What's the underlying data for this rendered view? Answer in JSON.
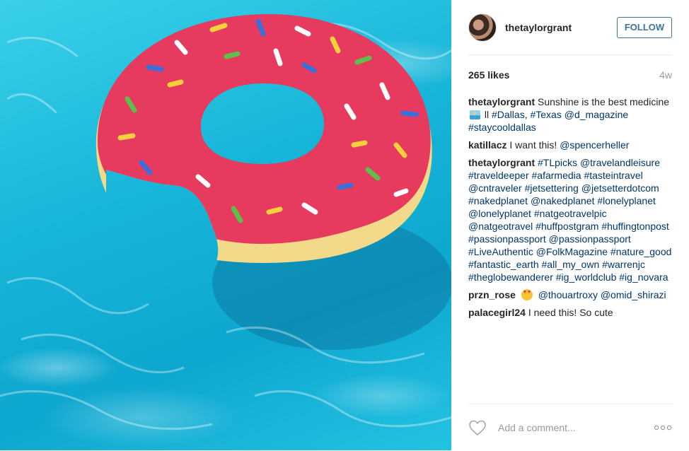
{
  "post": {
    "image_alt": "Donut pool float in a swimming pool",
    "header": {
      "username": "thetaylorgrant",
      "follow_label": "FOLLOW"
    },
    "likes": "265 likes",
    "time_ago": "4w",
    "caption": {
      "username": "thetaylorgrant",
      "text_1": "Sunshine is the best medicine",
      "emoji": "swimmer-emoji",
      "separator": " ll ",
      "tags": [
        "#Dallas",
        "#Texas",
        "@d_magazine",
        "#staycooldallas"
      ]
    },
    "comments": [
      {
        "username": "katillacz",
        "text": "I want this!",
        "mentions": [
          "@spencerheller"
        ]
      },
      {
        "username": "thetaylorgrant",
        "tags": [
          "#TLpicks",
          "@travelandleisure",
          "#traveldeeper",
          "#afarmedia",
          "#tasteintravel",
          "@cntraveler",
          "#jetsettering",
          "@jetsetterdotcom",
          "#nakedplanet",
          "@nakedplanet",
          "#lonelyplanet",
          "@lonelyplanet",
          "#natgeotravelpic",
          "@natgeotravel",
          "#huffpostgram",
          "#huffingtonpost",
          "#passionpassport",
          "@passionpassport",
          "#LiveAuthentic",
          "@FolkMagazine",
          "#nature_good",
          "#fantastic_earth",
          "#all_my_own",
          "#warrenjc",
          "#theglobewanderer",
          "#ig_worldclub",
          "#ig_novara"
        ]
      },
      {
        "username": "przn_rose",
        "emoji": "heart-eyes-emoji",
        "mentions": [
          "@thouartroxy",
          "@omid_shirazi"
        ]
      },
      {
        "username": "palacegirl24",
        "text": "I need this! So cute"
      }
    ],
    "add_comment_placeholder": "Add a comment...",
    "colors": {
      "link": "#003569",
      "follow_accent": "#3f729b",
      "muted": "#999999",
      "donut_icing": "#e63a5e",
      "donut_dough": "#f3d98a",
      "water": "#17b5d8"
    }
  }
}
